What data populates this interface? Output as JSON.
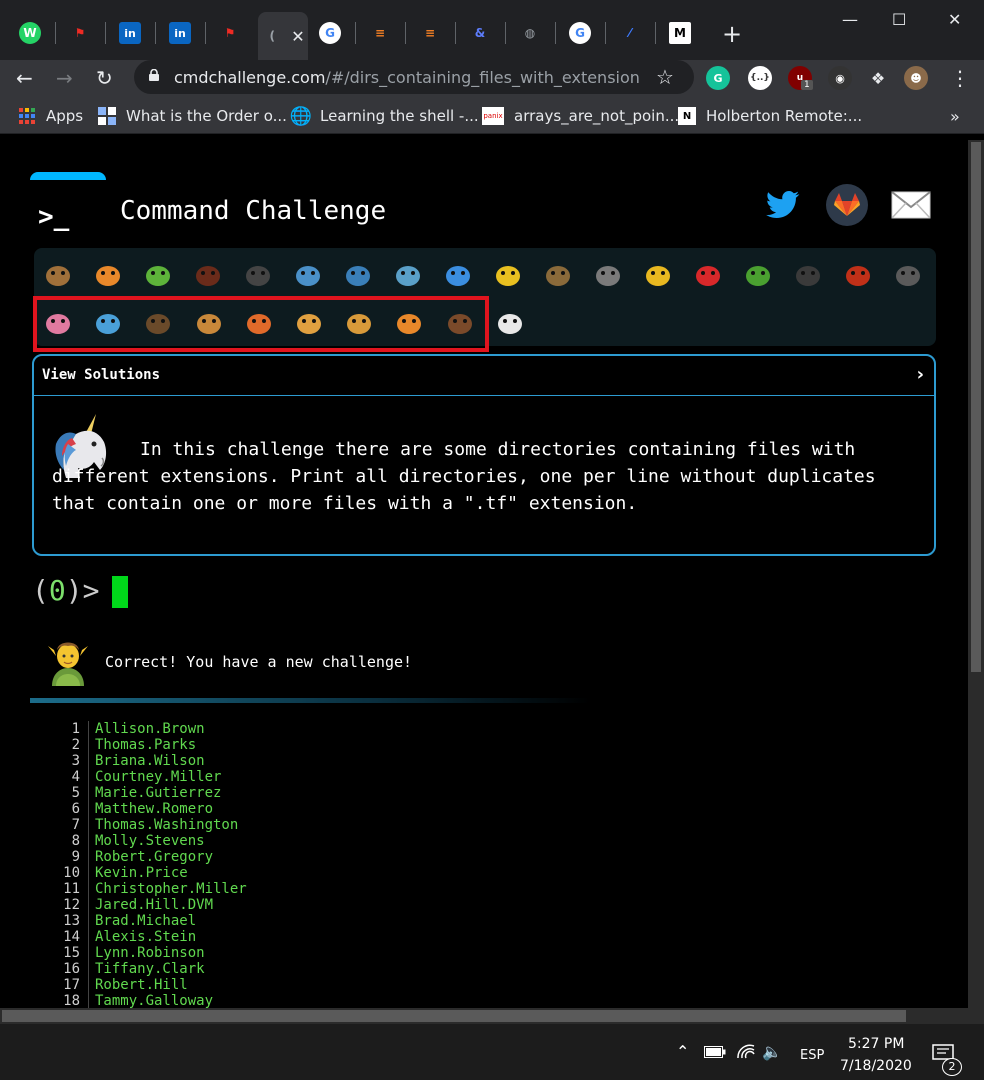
{
  "browser": {
    "tabs": [
      {
        "name": "whatsapp",
        "color": "#25d366",
        "glyph": "W"
      },
      {
        "name": "redhat",
        "color": "#ee2b24",
        "glyph": "⚑"
      },
      {
        "name": "linkedin",
        "color": "#0a66c2",
        "glyph": "in"
      },
      {
        "name": "linkedin",
        "color": "#0a66c2",
        "glyph": "in"
      },
      {
        "name": "redhat",
        "color": "#ee2b24",
        "glyph": "⚑"
      },
      {
        "name": "active",
        "color": "#9aa0a6",
        "glyph": "("
      },
      {
        "name": "google",
        "color": "#ffffff",
        "glyph": "G"
      },
      {
        "name": "stackoverflow",
        "color": "#f48024",
        "glyph": "≡"
      },
      {
        "name": "stackoverflow",
        "color": "#f48024",
        "glyph": "≡"
      },
      {
        "name": "regex",
        "color": "#5c7cfa",
        "glyph": "&"
      },
      {
        "name": "globe",
        "color": "#9aa0a6",
        "glyph": "◍"
      },
      {
        "name": "google",
        "color": "#ffffff",
        "glyph": "G"
      },
      {
        "name": "slash",
        "color": "#3d7bff",
        "glyph": "⁄"
      },
      {
        "name": "medium",
        "color": "#ffffff",
        "glyph": "M"
      }
    ],
    "active_tab_close": "✕",
    "new_tab": "+",
    "url_host": "cmdchallenge.com",
    "url_path": "/#/dirs_containing_files_with_extension",
    "extension_badge": "1",
    "bookmarks": [
      {
        "label": "Apps"
      },
      {
        "label": "What is the Order o..."
      },
      {
        "label": "Learning the shell -..."
      },
      {
        "label": "arrays_are_not_poin..."
      },
      {
        "label": "Holberton Remote:..."
      }
    ],
    "bookmarks_more": "»"
  },
  "page": {
    "logo": ">_",
    "title": "Command Challenge",
    "view_solutions": "View Solutions",
    "chevron": "›",
    "description": "In this challenge there are some directories containing files with different extensions. Print all directories, one per line without duplicates that contain one or more files with a \".tf\" extension.",
    "prompt_open": "(",
    "prompt_num": "0",
    "prompt_close": ")>",
    "correct_message": "Correct! You have a new challenge!",
    "output": [
      {
        "n": "1",
        "name": "Allison.Brown"
      },
      {
        "n": "2",
        "name": "Thomas.Parks"
      },
      {
        "n": "3",
        "name": "Briana.Wilson"
      },
      {
        "n": "4",
        "name": "Courtney.Miller"
      },
      {
        "n": "5",
        "name": "Marie.Gutierrez"
      },
      {
        "n": "6",
        "name": "Matthew.Romero"
      },
      {
        "n": "7",
        "name": "Thomas.Washington"
      },
      {
        "n": "8",
        "name": "Molly.Stevens"
      },
      {
        "n": "9",
        "name": "Robert.Gregory"
      },
      {
        "n": "10",
        "name": "Kevin.Price"
      },
      {
        "n": "11",
        "name": "Christopher.Miller"
      },
      {
        "n": "12",
        "name": "Jared.Hill.DVM"
      },
      {
        "n": "13",
        "name": "Brad.Michael"
      },
      {
        "n": "14",
        "name": "Alexis.Stein"
      },
      {
        "n": "15",
        "name": "Lynn.Robinson"
      },
      {
        "n": "16",
        "name": "Tiffany.Clark"
      },
      {
        "n": "17",
        "name": "Robert.Hill"
      },
      {
        "n": "18",
        "name": "Tammy.Galloway"
      }
    ]
  },
  "animals_row1": [
    {
      "name": "snail",
      "color": "#a0703a"
    },
    {
      "name": "butterfly",
      "color": "#e8882a"
    },
    {
      "name": "caterpillar",
      "color": "#5db33a"
    },
    {
      "name": "ant",
      "color": "#6a2b1a"
    },
    {
      "name": "spider-web",
      "color": "#444"
    },
    {
      "name": "whale",
      "color": "#4a90c8"
    },
    {
      "name": "shark",
      "color": "#3a7fb8"
    },
    {
      "name": "dolphin",
      "color": "#5aa0c8"
    },
    {
      "name": "fish",
      "color": "#3b8ee0"
    },
    {
      "name": "tropical-fish",
      "color": "#e8c020"
    },
    {
      "name": "blowfish",
      "color": "#8a6a3a"
    },
    {
      "name": "wolf",
      "color": "#7a7a7a"
    },
    {
      "name": "bee",
      "color": "#e8b820"
    },
    {
      "name": "ladybug",
      "color": "#d8282a"
    },
    {
      "name": "cricket",
      "color": "#4aa030"
    },
    {
      "name": "spider",
      "color": "#3a3a3a"
    },
    {
      "name": "scorpion",
      "color": "#c03018"
    },
    {
      "name": "fly",
      "color": "#5a5a5a"
    }
  ],
  "animals_row2": [
    {
      "name": "worm",
      "color": "#e07aa0"
    },
    {
      "name": "microbe",
      "color": "#4aa0d8"
    },
    {
      "name": "monkey",
      "color": "#6a4a2a"
    },
    {
      "name": "dog",
      "color": "#c8883a"
    },
    {
      "name": "fox",
      "color": "#e06a2a"
    },
    {
      "name": "cat",
      "color": "#e0a040"
    },
    {
      "name": "lion",
      "color": "#d89a3a"
    },
    {
      "name": "tiger",
      "color": "#e8882a"
    },
    {
      "name": "horse",
      "color": "#7a4a2a"
    },
    {
      "name": "unicorn",
      "color": "#e8e8e8"
    }
  ],
  "taskbar": {
    "language": "ESP",
    "time": "5:27 PM",
    "date": "7/18/2020",
    "notifications": "2"
  }
}
